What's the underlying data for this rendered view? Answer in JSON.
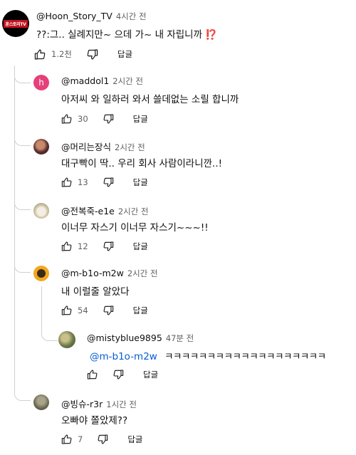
{
  "main_comment": {
    "author": "@Hoon_Story_TV",
    "time": "4시간 전",
    "text": "??:그.. 실례지만~ 으데 가~ 내 자립니까",
    "emoji": "⁉️",
    "likes": "1.2천",
    "reply_label": "답글",
    "avatar_text": "훈스토리TV",
    "avatar_color": "#000000"
  },
  "replies": [
    {
      "author": "@maddol1",
      "time": "2시간 전",
      "text": "아저씨 와 일하러 와서 쓸데없는 소릴 합니까",
      "likes": "30",
      "reply_label": "답글",
      "avatar_letter": "h",
      "avatar_color": "#e5407a"
    },
    {
      "author": "@머리는장식",
      "time": "2시간 전",
      "text": "대구빡이 딱.. 우리 회사 사람이라니깐..!",
      "likes": "13",
      "reply_label": "답글",
      "avatar_color": "#6b3b3b"
    },
    {
      "author": "@전복죽-e1e",
      "time": "2시간 전",
      "text": "이너무 자스기 이너무 자스기~~~!!",
      "likes": "12",
      "reply_label": "답글",
      "avatar_color": "#d9d0bd"
    },
    {
      "author": "@m-b1o-m2w",
      "time": "2시간 전",
      "text": "내 이럴줄 알았다",
      "likes": "54",
      "reply_label": "답글",
      "avatar_color": "#f2a81d"
    },
    {
      "author": "@mistyblue9895",
      "time": "47분 전",
      "mention": "@m-b1o-m2w",
      "text": "ㅋㅋㅋㅋㅋㅋㅋㅋㅋㅋㅋㅋㅋㅋㅋㅋㅋㅋㅋ",
      "likes": "",
      "reply_label": "답글",
      "avatar_color": "#8c8a5a"
    },
    {
      "author": "@빙슈-r3r",
      "time": "1시간 전",
      "text": "오빠야 쫄았제??",
      "likes": "7",
      "reply_label": "답글",
      "avatar_color": "#7a7a5c"
    }
  ],
  "icons": {
    "like": "thumbs-up-icon",
    "dislike": "thumbs-down-icon"
  },
  "colors": {
    "link": "#065fd4",
    "meta": "#606060",
    "thread_line": "#d0d0d0"
  }
}
